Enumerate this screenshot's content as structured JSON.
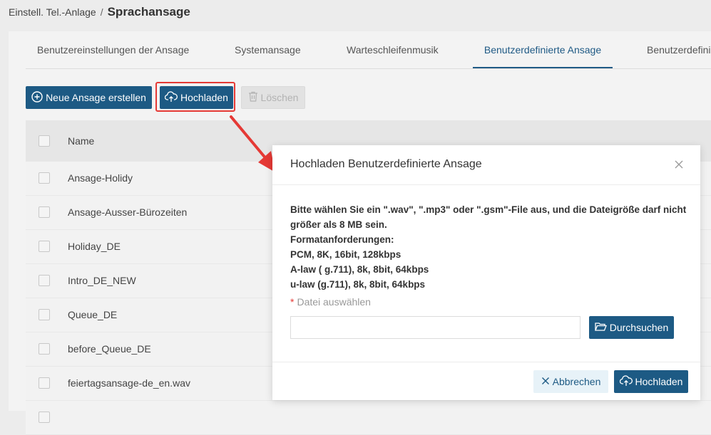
{
  "breadcrumb": {
    "parent": "Einstell. Tel.-Anlage",
    "separator": "/",
    "current": "Sprachansage"
  },
  "tabs": [
    {
      "label": "Benutzereinstellungen der Ansage",
      "active": false
    },
    {
      "label": "Systemansage",
      "active": false
    },
    {
      "label": "Warteschleifenmusik",
      "active": false
    },
    {
      "label": "Benutzerdefinierte Ansage",
      "active": true
    },
    {
      "label": "Benutzerdefini",
      "active": false
    }
  ],
  "toolbar": {
    "new_label": "Neue Ansage erstellen",
    "upload_label": "Hochladen",
    "delete_label": "Löschen"
  },
  "table": {
    "header": "Name",
    "rows": [
      "Ansage-Holidy",
      "Ansage-Ausser-Bürozeiten",
      "Holiday_DE",
      "Intro_DE_NEW",
      "Queue_DE",
      "before_Queue_DE",
      "feiertagsansage-de_en.wav"
    ]
  },
  "modal": {
    "title": "Hochladen Benutzerdefinierte Ansage",
    "info_lines": [
      "Bitte wählen Sie ein \".wav\", \".mp3\" oder \".gsm\"-File aus, und die Dateigröße darf nicht größer als 8 MB sein.",
      "Formatanforderungen:",
      "PCM, 8K, 16bit, 128kbps",
      "A-law ( g.711), 8k, 8bit, 64kbps",
      "u-law (g.711), 8k, 8bit, 64kbps"
    ],
    "required_mark": "*",
    "file_label": "Datei auswählen",
    "file_value": "",
    "browse_label": "Durchsuchen",
    "cancel_label": "Abbrechen",
    "upload_label": "Hochladen"
  },
  "colors": {
    "primary": "#1d5a84",
    "highlight": "#e53935",
    "disabled": "#e2e2e2"
  }
}
